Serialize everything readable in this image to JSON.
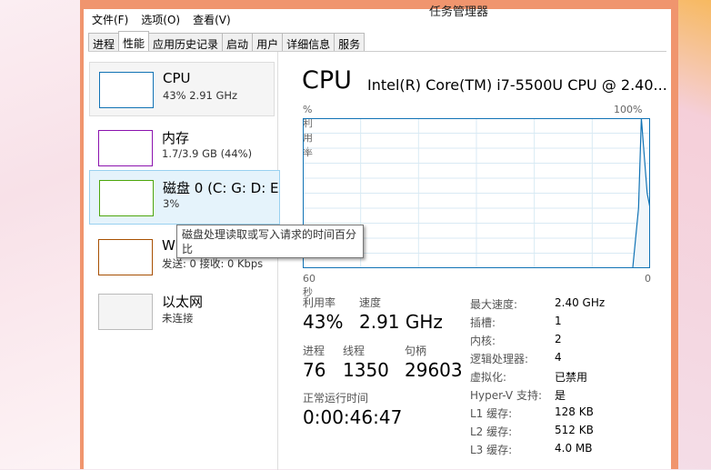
{
  "window": {
    "title": "任务管理器"
  },
  "menu": [
    "文件(F)",
    "选项(O)",
    "查看(V)"
  ],
  "tabs": [
    {
      "label": "进程"
    },
    {
      "label": "性能",
      "active": true
    },
    {
      "label": "应用历史记录"
    },
    {
      "label": "启动"
    },
    {
      "label": "用户"
    },
    {
      "label": "详细信息"
    },
    {
      "label": "服务"
    }
  ],
  "sidebar": [
    {
      "title": "CPU",
      "sub": "43% 2.91 GHz",
      "color": "#1173b5"
    },
    {
      "title": "内存",
      "sub": "1.7/3.9 GB (44%)",
      "color": "#8b12ae"
    },
    {
      "title": "磁盘 0 (C: G: D: E",
      "sub": "3%",
      "color": "#4da60c"
    },
    {
      "title": "Wi-Fi",
      "sub": "发送: 0 接收: 0 Kbps",
      "color": "#a74f01"
    },
    {
      "title": "以太网",
      "sub": "未连接",
      "color": "#bbbbbb"
    }
  ],
  "tooltip": "磁盘处理读取或写入请求的时间百分比",
  "main": {
    "title": "CPU",
    "model": "Intel(R) Core(TM) i7-5500U CPU @ 2.40...",
    "ylabel": "% 利用率",
    "ymax": "100%",
    "xleft": "60 秒",
    "xright": "0",
    "stats": {
      "util_label": "利用率",
      "util": "43%",
      "speed_label": "速度",
      "speed": "2.91 GHz",
      "proc_label": "进程",
      "proc": "76",
      "threads_label": "线程",
      "threads": "1350",
      "handles_label": "句柄",
      "handles": "29603",
      "uptime_label": "正常运行时间",
      "uptime": "0:00:46:47"
    },
    "specs": [
      [
        "最大速度:",
        "2.40 GHz"
      ],
      [
        "插槽:",
        "1"
      ],
      [
        "内核:",
        "2"
      ],
      [
        "逻辑处理器:",
        "4"
      ],
      [
        "虚拟化:",
        "已禁用"
      ],
      [
        "Hyper-V 支持:",
        "是"
      ],
      [
        "L1 缓存:",
        "128 KB"
      ],
      [
        "L2 缓存:",
        "512 KB"
      ],
      [
        "L3 缓存:",
        "4.0 MB"
      ]
    ]
  },
  "chart_data": {
    "type": "area",
    "x_seconds_ago": [
      60,
      3,
      2,
      1.5,
      0.5,
      0
    ],
    "values": [
      0,
      0,
      40,
      100,
      50,
      40
    ],
    "ylim": [
      0,
      100
    ],
    "xlim": [
      60,
      0
    ],
    "grid": true,
    "color": "#1173b5"
  }
}
